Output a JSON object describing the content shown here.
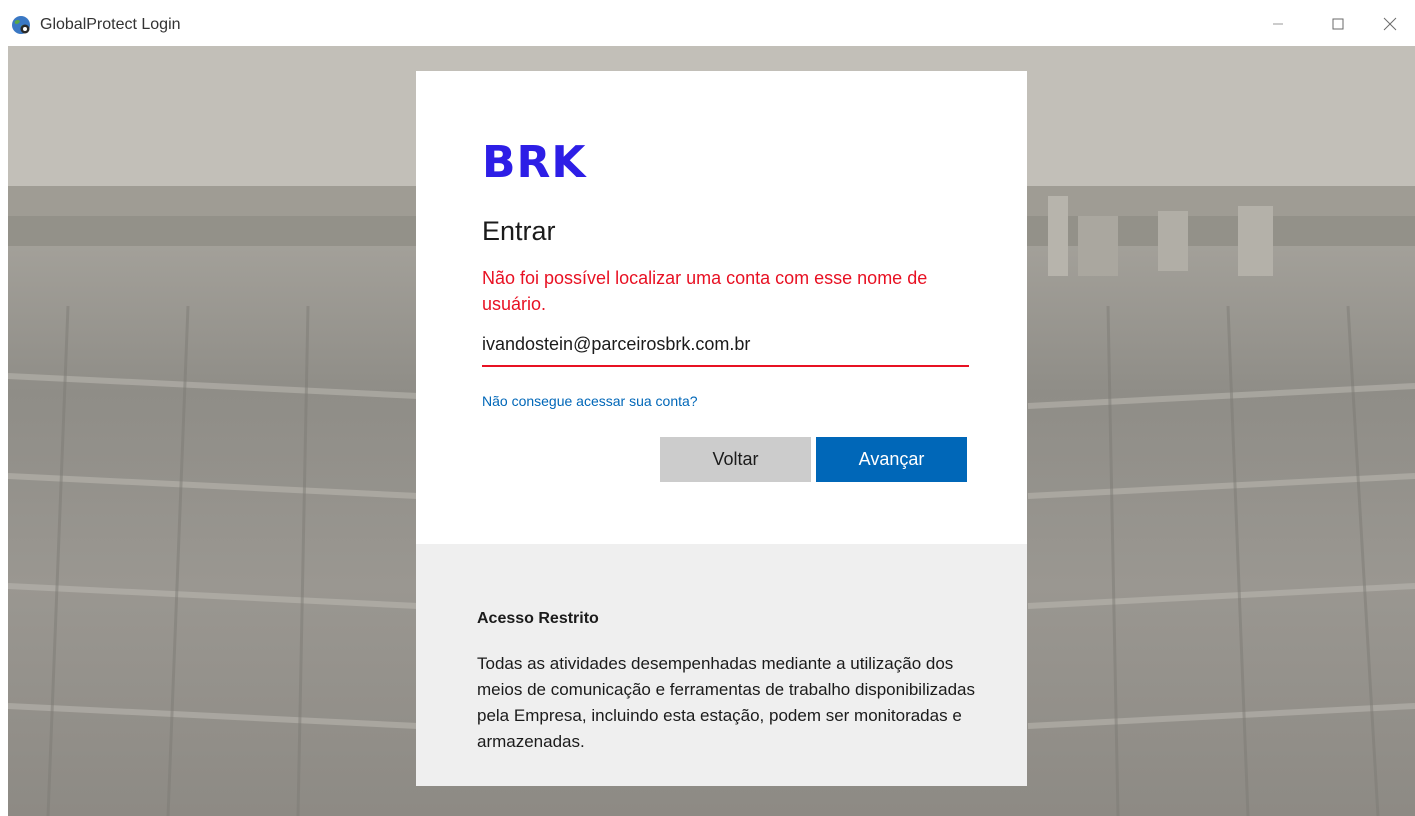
{
  "window": {
    "title": "GlobalProtect Login",
    "icon": "globalprotect-globe-icon",
    "controls": {
      "minimize_icon": "minimize-icon",
      "maximize_icon": "maximize-icon",
      "close_icon": "close-icon"
    }
  },
  "login": {
    "logo_text": "BRK",
    "heading": "Entrar",
    "error_message": "Não foi possível localizar uma conta com esse nome de usuário.",
    "email_value": "ivandostein@parceirosbrk.com.br",
    "help_link": "Não consegue acessar sua conta?",
    "back_button": "Voltar",
    "next_button": "Avançar"
  },
  "notice": {
    "title": "Acesso Restrito",
    "body": "Todas as atividades desempenhadas mediante a utilização dos meios de comunicação e ferramentas de trabalho disponibilizadas pela Empresa, incluindo esta estação, podem ser monitoradas e armazenadas."
  },
  "colors": {
    "brand": "#2d1ee6",
    "error": "#e81123",
    "link": "#0067b8",
    "primary_button": "#0067b8",
    "secondary_button": "#cccccc"
  }
}
